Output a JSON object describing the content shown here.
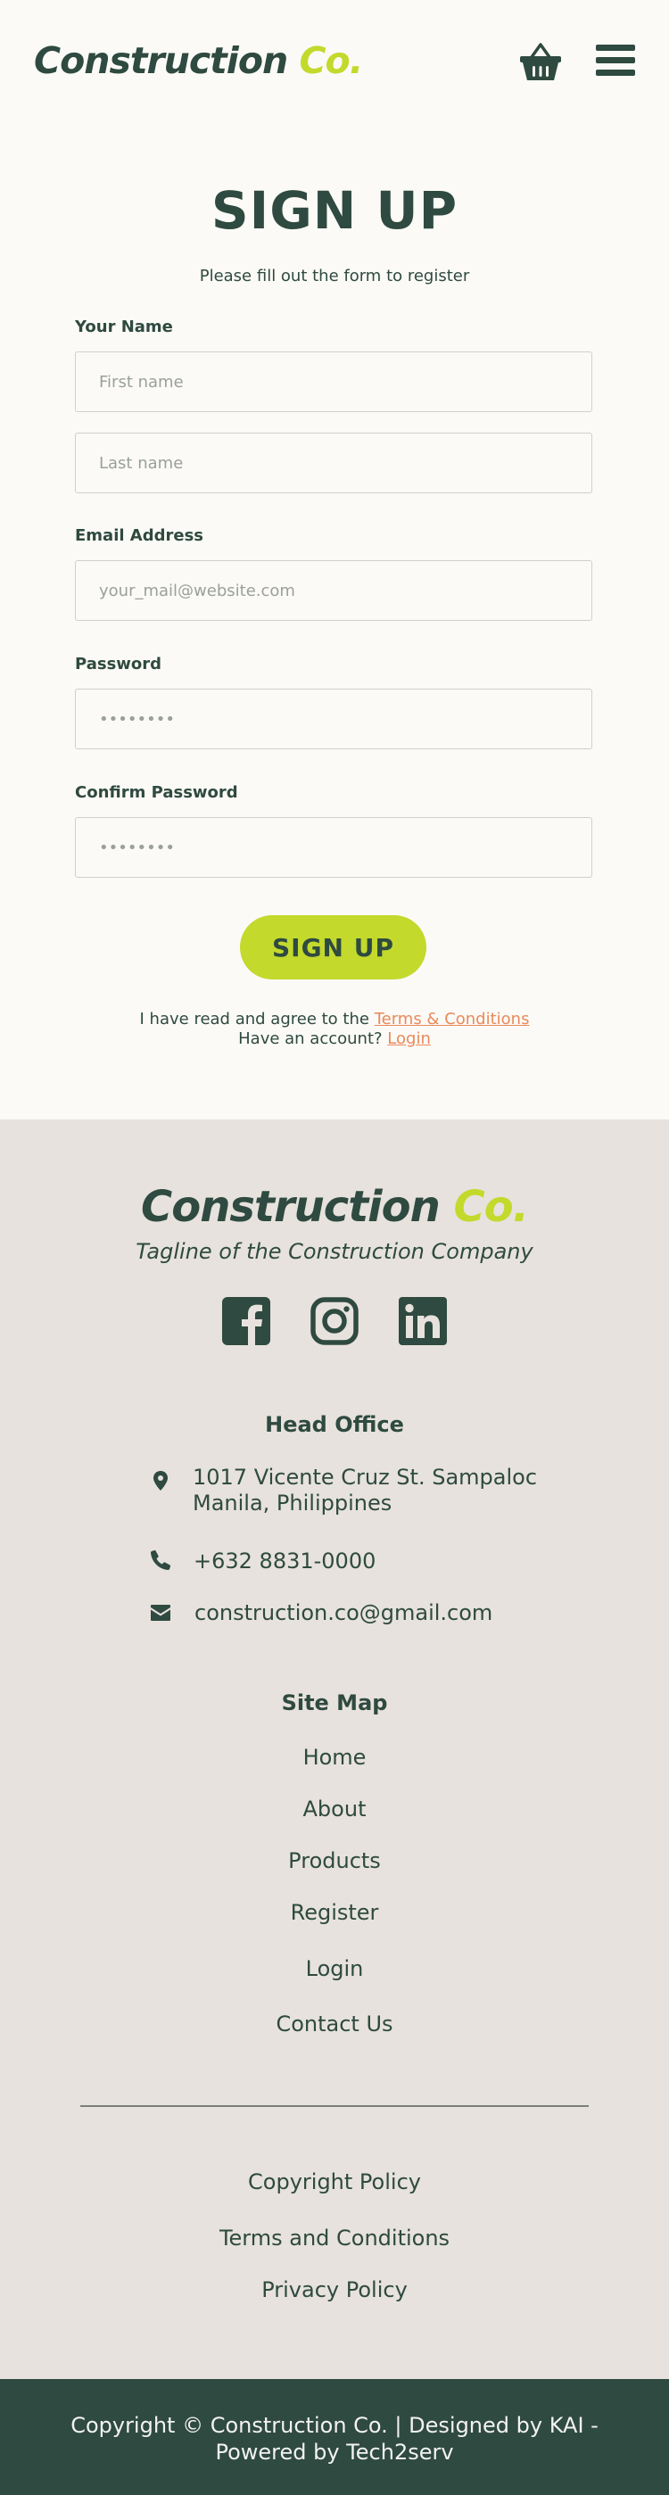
{
  "header": {
    "logo_main": "Construction",
    "logo_accent": "Co.",
    "cart_icon": "basket-icon",
    "menu_icon": "hamburger-menu-icon"
  },
  "form": {
    "title": "SIGN UP",
    "subtitle": "Please fill out the form to register",
    "name_label": "Your Name",
    "first_name_placeholder": "First name",
    "last_name_placeholder": "Last name",
    "email_label": "Email Address",
    "email_placeholder": "your_mail@website.com",
    "password_label": "Password",
    "password_placeholder": "••••••••",
    "confirm_label": "Confirm Password",
    "confirm_placeholder": "••••••••",
    "submit_label": "SIGN UP",
    "agree_text": "I have read and agree to the",
    "terms_link": "Terms & Conditions",
    "have_account_text": "Have an account?",
    "login_link": "Login"
  },
  "footer": {
    "logo_main": "Construction",
    "logo_accent": "Co.",
    "tagline": "Tagline of the Construction Company",
    "social": [
      "facebook-icon",
      "instagram-icon",
      "linkedin-icon"
    ],
    "head_office_title": "Head Office",
    "address_line1": "1017 Vicente Cruz St. Sampaloc",
    "address_line2": "Manila, Philippines",
    "phone": "+632 8831-0000",
    "email": "construction.co@gmail.com",
    "sitemap_title": "Site Map",
    "sitemap": [
      "Home",
      "About",
      "Products",
      "Register",
      "Login",
      "Contact Us"
    ],
    "policies": [
      "Copyright Policy",
      "Terms and Conditions",
      "Privacy Policy"
    ]
  },
  "bottom_bar": {
    "line1": "Copyright © Construction Co.  | Designed by KAI -",
    "line2": "Powered by Tech2serv"
  },
  "colors": {
    "primary": "#2f4a40",
    "accent": "#c3d92c",
    "link": "#e98a5a",
    "page_bg": "#fbfaf7",
    "footer_bg": "#e7e2dd"
  }
}
